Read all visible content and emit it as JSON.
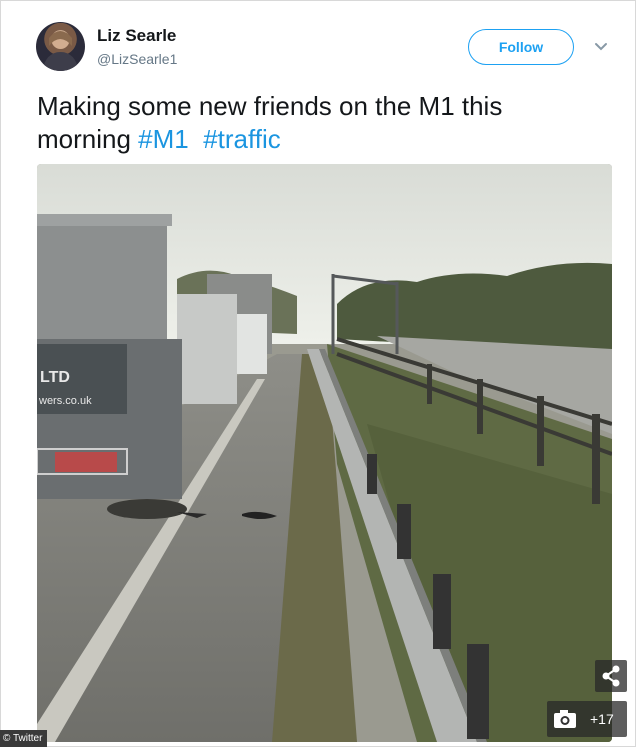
{
  "tweet": {
    "display_name": "Liz Searle",
    "handle": "@LizSearle1",
    "follow_label": "Follow",
    "text": "Making some new friends on the M1 this morning",
    "hashtags": [
      "#M1",
      "#traffic"
    ]
  },
  "photo": {
    "van_sign_text_1": "LTD",
    "van_sign_text_2": "wers.co.uk"
  },
  "overlay": {
    "credit": "© Twitter",
    "gallery_count": "+17"
  },
  "icons": {
    "chevron": "chevron-down-icon",
    "share": "share-icon",
    "camera": "camera-icon"
  },
  "colors": {
    "accent": "#1da1f2",
    "hashtag": "#1b95e0",
    "name": "#14171a",
    "handle": "#657786"
  }
}
